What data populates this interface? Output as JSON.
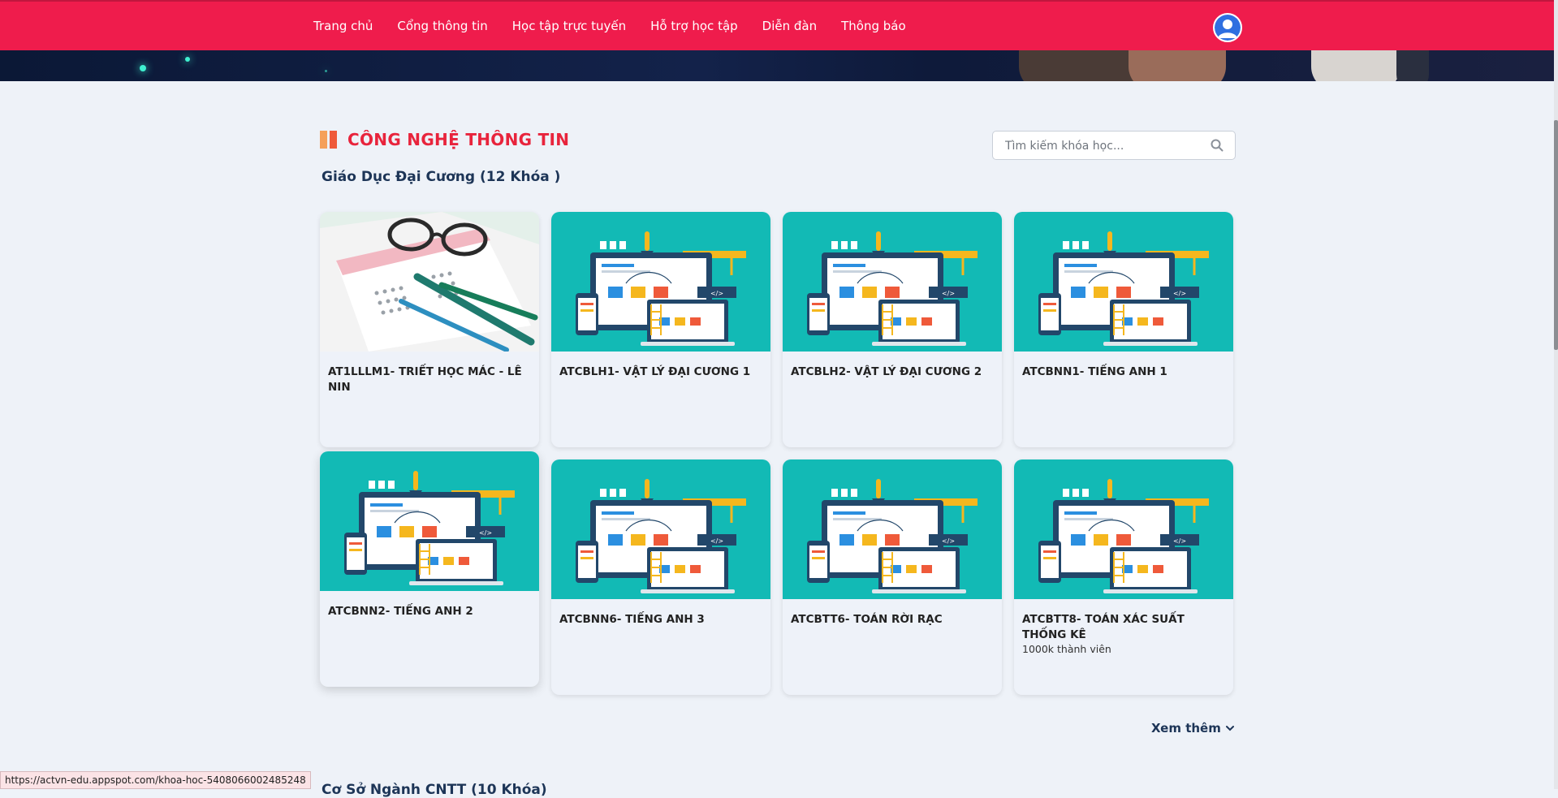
{
  "nav": {
    "items": [
      "Trang chủ",
      "Cổng thông tin",
      "Học tập trực tuyến",
      "Hỗ trợ học tập",
      "Diễn đàn",
      "Thông báo"
    ]
  },
  "section": {
    "title": "CÔNG NGHỆ THÔNG TIN",
    "subtitle": "Giáo Dục Đại Cương (12 Khóa )"
  },
  "search": {
    "placeholder": "Tìm kiếm khóa học..."
  },
  "courses": [
    {
      "title": "AT1LLLM1- TRIẾT HỌC MÁC - LÊ NIN",
      "image": "exam-sheet-glasses"
    },
    {
      "title": "ATCBLH1- VẬT LÝ ĐẠI CƯƠNG 1",
      "image": "web-design-illustration"
    },
    {
      "title": "ATCBLH2- VẬT LÝ ĐẠI CƯƠNG 2",
      "image": "web-design-illustration"
    },
    {
      "title": "ATCBNN1- TIẾNG ANH 1",
      "image": "web-design-illustration"
    },
    {
      "title": "ATCBNN2- TIẾNG ANH 2",
      "image": "web-design-illustration"
    },
    {
      "title": "ATCBNN6- TIẾNG ANH 3",
      "image": "web-design-illustration"
    },
    {
      "title": "ATCBTT6- TOÁN RỜI RẠC",
      "image": "web-design-illustration"
    },
    {
      "title": "ATCBTT8- TOÁN XÁC SUẤT THỐNG KÊ",
      "members": "1000k thành viên",
      "image": "web-design-illustration"
    }
  ],
  "see_more": "Xem thêm",
  "next_section_title": "Cơ Sở Ngành CNTT (10 Khóa)",
  "status_url": "https://actvn-edu.appspot.com/khoa-hoc-5408066002485248",
  "colors": {
    "nav_bg": "#ef1c4c",
    "accent_title": "#e8243c",
    "subtitle": "#1d3557",
    "thumb_teal": "#12bab5"
  }
}
